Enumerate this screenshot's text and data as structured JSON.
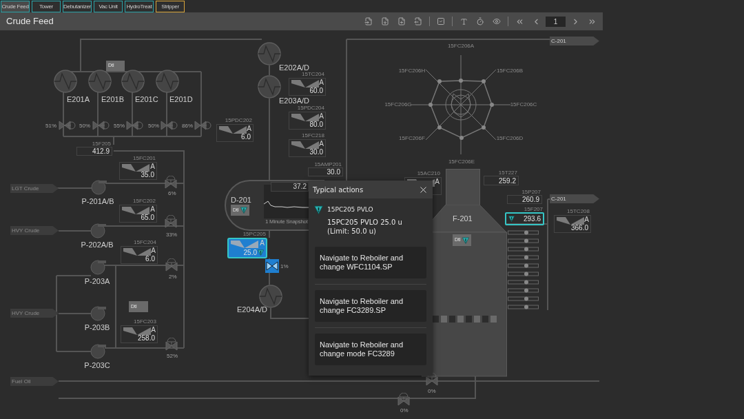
{
  "tabs": [
    {
      "label": "Crude Feed",
      "selected": true,
      "color": "#2aa3a8"
    },
    {
      "label": "Tower",
      "selected": false,
      "color": "#2aa3a8"
    },
    {
      "label": "Debutanizer",
      "selected": false,
      "color": "#2aa3a8"
    },
    {
      "label": "Vac Unit",
      "selected": false,
      "color": "#2aa3a8"
    },
    {
      "label": "HydroTreat",
      "selected": false,
      "color": "#2aa3a8"
    },
    {
      "label": "Stripper",
      "selected": false,
      "color": "#d9a53a"
    }
  ],
  "title": "Crude Feed",
  "toolbar": {
    "page": "1"
  },
  "exchangers": [
    {
      "label": "E201A"
    },
    {
      "label": "E201B"
    },
    {
      "label": "E201C"
    },
    {
      "label": "E201D"
    },
    {
      "label": "E202A/D"
    },
    {
      "label": "E203A/D"
    },
    {
      "label": "E204A/D"
    }
  ],
  "valves": [
    {
      "reading": "51%",
      "selected": false
    },
    {
      "reading": "50%",
      "selected": false
    },
    {
      "reading": "55%",
      "selected": false
    },
    {
      "reading": "50%",
      "selected": false
    },
    {
      "reading": "86%",
      "selected": false
    },
    {
      "reading": "6%",
      "selected": false
    },
    {
      "reading": "33%",
      "selected": false
    },
    {
      "reading": "2%",
      "selected": false
    },
    {
      "reading": "52%",
      "selected": false
    },
    {
      "reading": "1%",
      "selected": true
    },
    {
      "reading": "0%",
      "selected": false
    },
    {
      "reading": "0%",
      "selected": false
    }
  ],
  "pumps": [
    {
      "label": "P-201A/B"
    },
    {
      "label": "P-202A/B"
    },
    {
      "label": "P-203A"
    },
    {
      "label": "P-203B"
    },
    {
      "label": "P-203C"
    }
  ],
  "streams": [
    {
      "label": "LGT Crude",
      "kind": "inlet"
    },
    {
      "label": "HVY Crude",
      "kind": "inlet"
    },
    {
      "label": "HVY Crude",
      "kind": "inlet"
    },
    {
      "label": "Fuel Oil",
      "kind": "inlet"
    },
    {
      "label": "C-201",
      "kind": "outlet"
    },
    {
      "label": "C-201",
      "kind": "outlet"
    }
  ],
  "faceplates": [
    {
      "tag": "15TC204",
      "mode": "A",
      "value": "60.0",
      "selected": false,
      "alarm": false
    },
    {
      "tag": "15PDC204",
      "mode": "A",
      "value": "80.0",
      "selected": false,
      "alarm": false
    },
    {
      "tag": "15FC218",
      "mode": "A",
      "value": "30.0",
      "selected": false,
      "alarm": false
    },
    {
      "tag": "15PDC202",
      "mode": "A",
      "value": "6.0",
      "selected": false,
      "alarm": false
    },
    {
      "tag": "15FC201",
      "mode": "A",
      "value": "35.0",
      "selected": false,
      "alarm": false
    },
    {
      "tag": "15FC202",
      "mode": "A",
      "value": "65.0",
      "selected": false,
      "alarm": false
    },
    {
      "tag": "15FC204",
      "mode": "A",
      "value": "6.0",
      "selected": false,
      "alarm": false
    },
    {
      "tag": "15FC203",
      "mode": "A",
      "value": "258.0",
      "selected": false,
      "alarm": false
    },
    {
      "tag": "15PC205",
      "mode": "A",
      "value": "25.0",
      "selected": true,
      "alarm": true
    },
    {
      "tag": "15AC210",
      "mode": "A",
      "selected": false
    },
    {
      "tag": "15TC208",
      "mode": "A",
      "value": "366.0",
      "selected": false,
      "alarm": false
    }
  ],
  "readouts": [
    {
      "tag": "15F205",
      "value": "412.9",
      "alarm": false
    },
    {
      "tag": "15AMP201",
      "value": "30.0",
      "alarm": false
    },
    {
      "tag": "15T227",
      "value": "259.2",
      "alarm": false
    },
    {
      "tag": "15P207",
      "value": "260.9",
      "alarm": false
    },
    {
      "tag": "15F207",
      "value": "293.6",
      "alarm": true
    }
  ],
  "detail_buttons": [
    {
      "label": "Dtl",
      "alarm": false
    },
    {
      "label": "Dtl",
      "alarm": false
    },
    {
      "label": "Dtl",
      "alarm": true
    },
    {
      "label": "Dtl",
      "alarm": true
    }
  ],
  "drum": {
    "label": "D-201",
    "trend_value": "37.2",
    "trend_caption": "1 Minute Snapshot"
  },
  "heater": {
    "label": "F-201"
  },
  "radar": {
    "labels": [
      "15FC206A",
      "15FC206B",
      "15FC206C",
      "15FC206D",
      "15FC206E",
      "15FC206F",
      "15FC206G",
      "15FC206H"
    ]
  },
  "popup": {
    "title": "Typical actions",
    "alarm_tag": "15PC205 PVLO",
    "message": "15PC205 PVLO 25.0 u",
    "limit": "(Limit: 50.0 u)",
    "actions": [
      "Navigate to Reboiler and change WFC1104.SP",
      "Navigate to Reboiler and change FC3289.SP",
      "Navigate to Reboiler and change mode FC3289"
    ]
  }
}
